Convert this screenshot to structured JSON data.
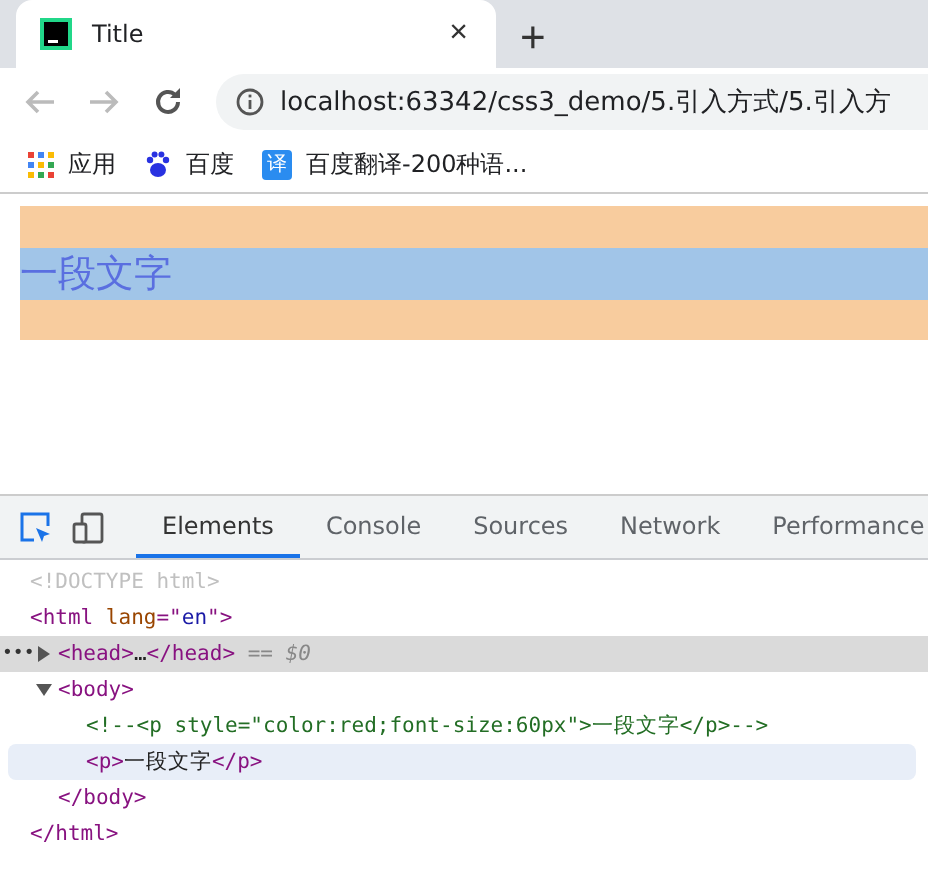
{
  "tab": {
    "title": "Title",
    "close": "×",
    "new_tab": "+"
  },
  "address": {
    "url": "localhost:63342/css3_demo/5.引入方式/5.引入方"
  },
  "bookmarks": [
    {
      "kind": "apps",
      "label": "应用"
    },
    {
      "kind": "paw",
      "label": "百度"
    },
    {
      "kind": "translate",
      "label": "百度翻译-200种语...",
      "badge": "译"
    }
  ],
  "page": {
    "paragraph": "一段文字"
  },
  "devtools": {
    "tabs": [
      {
        "label": "Elements",
        "selected": true
      },
      {
        "label": "Console",
        "selected": false
      },
      {
        "label": "Sources",
        "selected": false
      },
      {
        "label": "Network",
        "selected": false
      },
      {
        "label": "Performance",
        "selected": false
      }
    ],
    "tree": [
      {
        "tokens": [
          {
            "kind": "doctype",
            "text": "<!DOCTYPE html>"
          }
        ]
      },
      {
        "tokens": [
          {
            "kind": "tag",
            "text": "<html"
          },
          {
            "kind": "attr",
            "text": " lang"
          },
          {
            "kind": "tag",
            "text": "=\""
          },
          {
            "kind": "value",
            "text": "en"
          },
          {
            "kind": "tag",
            "text": "\">"
          }
        ],
        "children": [
          {
            "tokens": [
              {
                "kind": "tag",
                "text": "<head>"
              },
              {
                "kind": "text",
                "text": "…"
              },
              {
                "kind": "tag",
                "text": "</head>"
              },
              {
                "kind": "dim",
                "text": " == $0"
              }
            ],
            "expanded": false,
            "selected": true,
            "hovered": false,
            "gutter": "•••"
          },
          {
            "tokens": [
              {
                "kind": "tag",
                "text": "<body>"
              }
            ],
            "expanded": true,
            "selected": false,
            "hovered": false,
            "children": [
              {
                "tokens": [
                  {
                    "kind": "comment",
                    "text": "<!--<p style=\"color:red;font-size:60px\">一段文字</p>-->"
                  }
                ],
                "selected": false,
                "hovered": false
              },
              {
                "tokens": [
                  {
                    "kind": "tag",
                    "text": "<p>"
                  },
                  {
                    "kind": "text",
                    "text": "一段文字"
                  },
                  {
                    "kind": "tag",
                    "text": "</p>"
                  }
                ],
                "selected": false,
                "hovered": true
              }
            ],
            "close": [
              {
                "kind": "tag",
                "text": "</body>"
              }
            ]
          }
        ],
        "close": [
          {
            "kind": "tag",
            "text": "</html>"
          }
        ]
      }
    ]
  }
}
